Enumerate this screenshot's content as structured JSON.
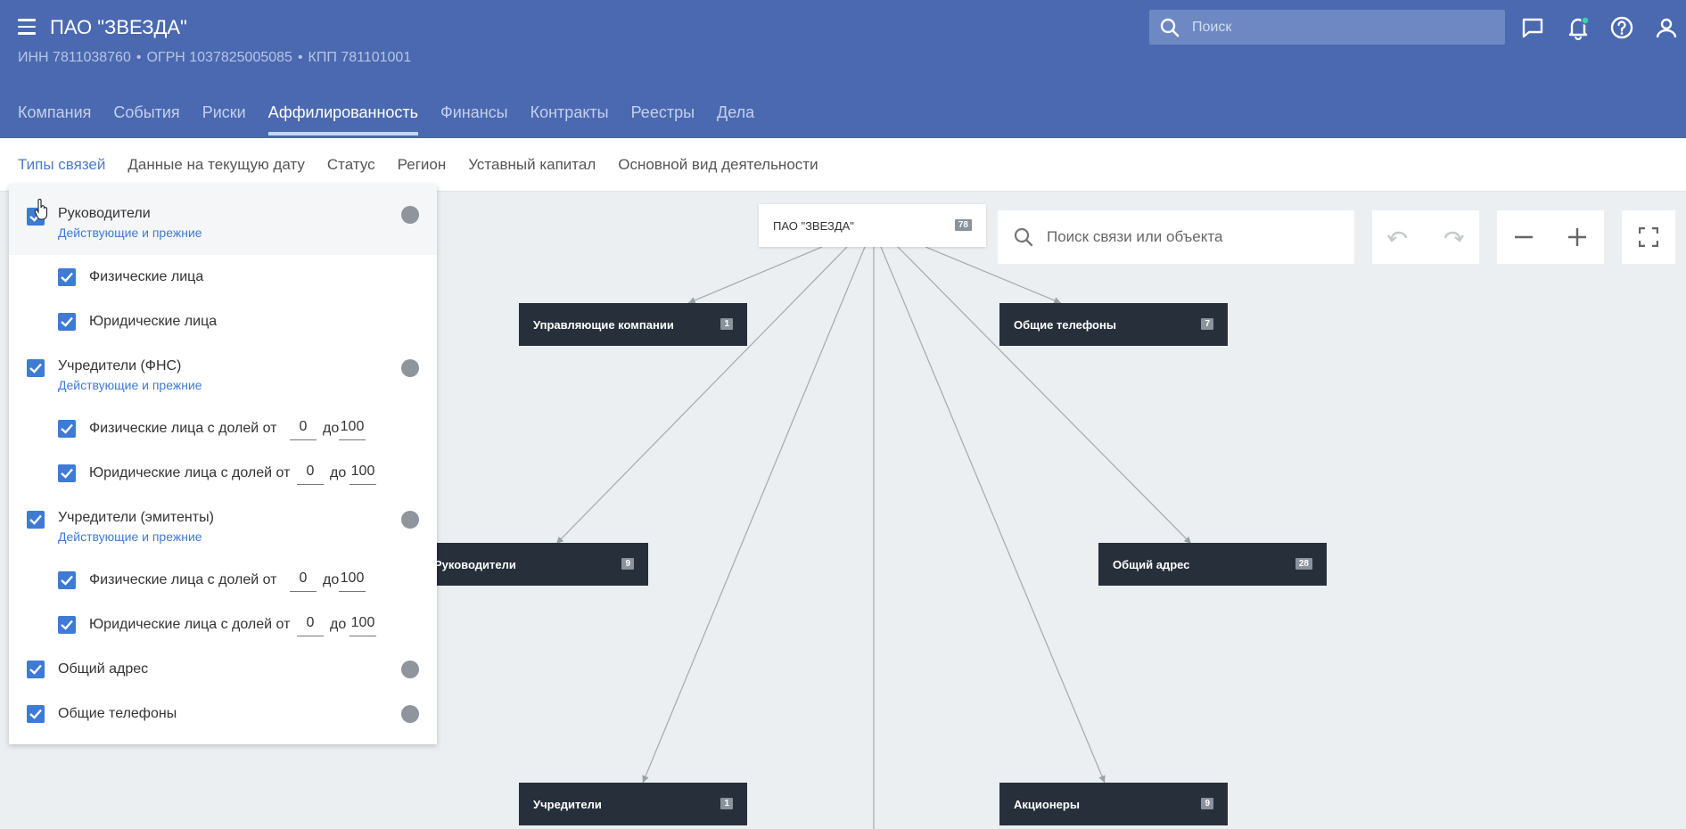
{
  "header": {
    "title": "ПАО \"ЗВЕЗДА\"",
    "inn": "ИНН 7811038760",
    "ogrn": "ОГРН 1037825005085",
    "kpp": "КПП 781101001",
    "separator": "•",
    "search_placeholder": "Поиск",
    "tabs": [
      {
        "label": "Компания"
      },
      {
        "label": "События"
      },
      {
        "label": "Риски"
      },
      {
        "label": "Аффилированность"
      },
      {
        "label": "Финансы"
      },
      {
        "label": "Контракты"
      },
      {
        "label": "Реестры"
      },
      {
        "label": "Дела"
      }
    ],
    "active_tab": "Аффилированность"
  },
  "subbar": {
    "tabs": [
      {
        "label": "Типы связей"
      },
      {
        "label": "Данные на текущую дату"
      },
      {
        "label": "Статус"
      },
      {
        "label": "Регион"
      },
      {
        "label": "Уставный капитал"
      },
      {
        "label": "Основной вид деятельности"
      }
    ],
    "active_tab": "Типы связей"
  },
  "filters": {
    "status_hint": "Действующие и прежние",
    "share_from_label": "до",
    "groups": [
      {
        "label": "Руководители",
        "checked": true,
        "children": [
          {
            "label": "Физические лица",
            "checked": true
          },
          {
            "label": "Юридические лица",
            "checked": true
          }
        ]
      },
      {
        "label": "Учредители (ФНС)",
        "checked": true,
        "children": [
          {
            "label": "Физические лица с долей от",
            "checked": true,
            "from": "0",
            "to": "100"
          },
          {
            "label": "Юридические лица с долей от",
            "checked": true,
            "from": "0",
            "to": "100"
          }
        ]
      },
      {
        "label": "Учредители (эмитенты)",
        "checked": true,
        "children": [
          {
            "label": "Физические лица с долей от",
            "checked": true,
            "from": "0",
            "to": "100"
          },
          {
            "label": "Юридические лица с долей от",
            "checked": true,
            "from": "0",
            "to": "100"
          }
        ]
      },
      {
        "label": "Общий адрес",
        "checked": true
      },
      {
        "label": "Общие телефоны",
        "checked": true
      }
    ]
  },
  "graph": {
    "search_placeholder": "Поиск связи или объекта",
    "root": {
      "label": "ПАО \"ЗВЕЗДА\"",
      "count": "78"
    },
    "nodes": [
      {
        "label": "Управляющие компании",
        "count": "1"
      },
      {
        "label": "Общие телефоны",
        "count": "7"
      },
      {
        "label": "Руководители",
        "count": "9"
      },
      {
        "label": "Общий адрес",
        "count": "28"
      },
      {
        "label": "Учредители",
        "count": "1"
      },
      {
        "label": "Акционеры",
        "count": "9"
      }
    ]
  },
  "colors": {
    "header_bg": "#4a69b0",
    "accent": "#3d7bd4",
    "node_bg": "#262f3a",
    "canvas_bg": "#eceff1"
  }
}
